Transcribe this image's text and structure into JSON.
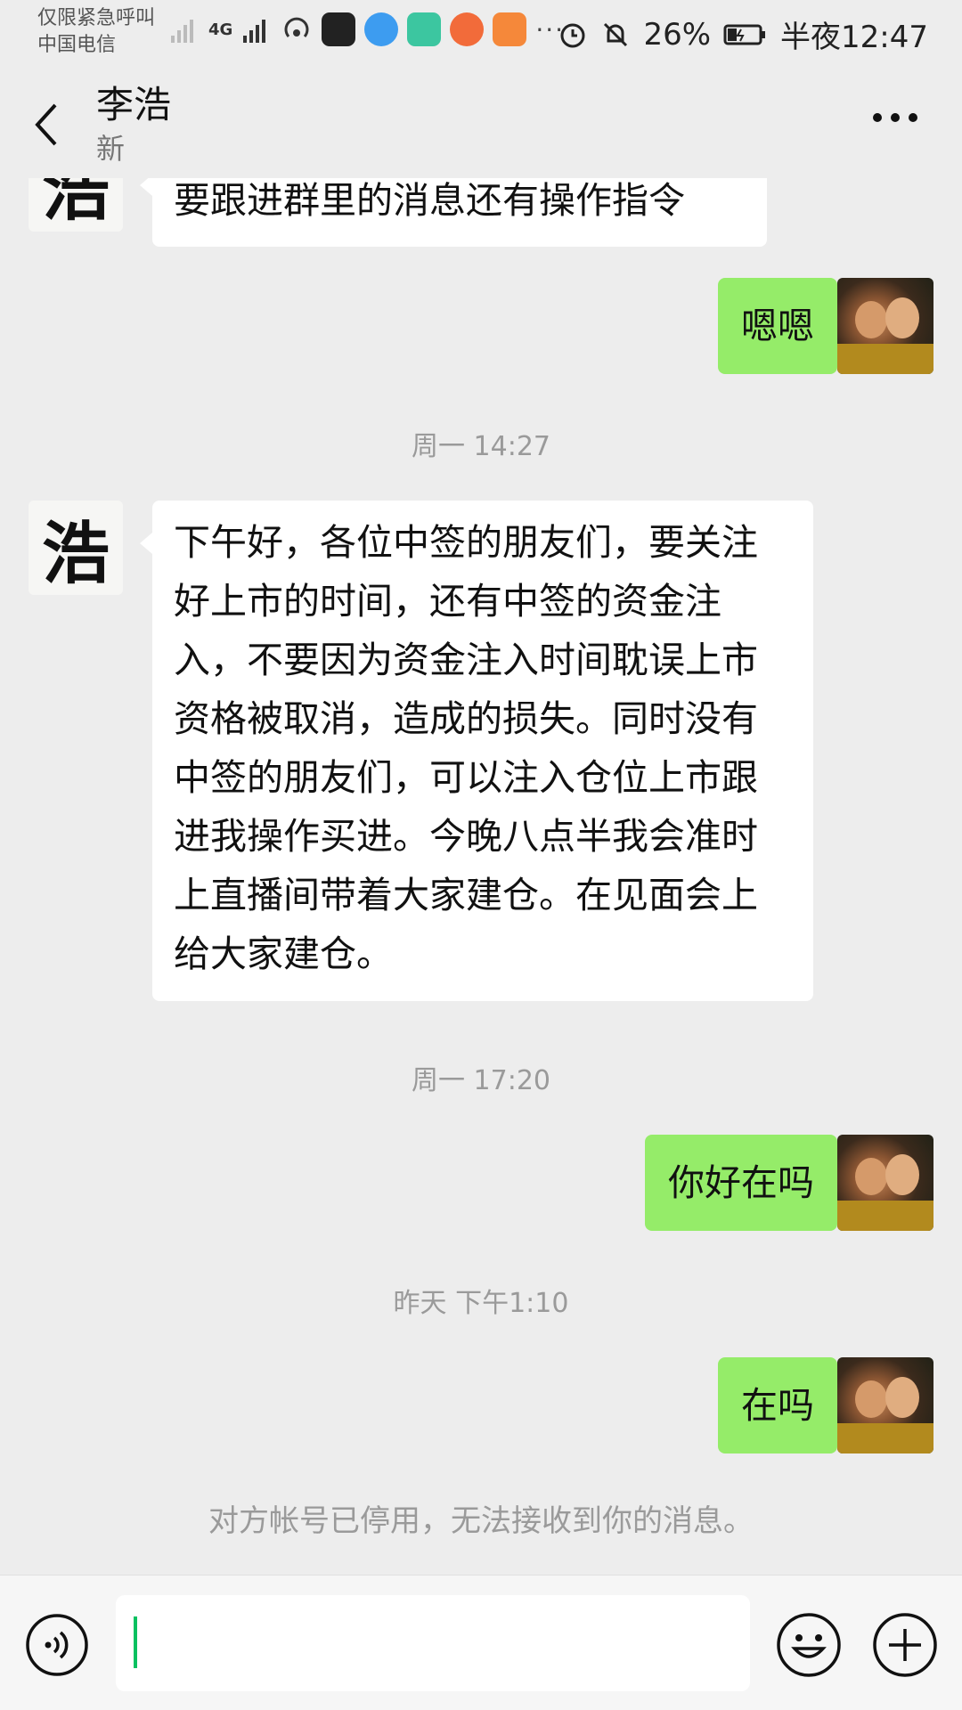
{
  "status_bar": {
    "carrier_line1": "仅限紧急呼叫",
    "carrier_line2": "中国电信",
    "network": "4G",
    "battery": "26%",
    "time": "半夜12:47",
    "more": "···"
  },
  "header": {
    "title": "李浩",
    "subtitle": "新"
  },
  "messages": {
    "m1_text": "要跟进群里的消息还有操作指令",
    "m2_text": "嗯嗯",
    "ts1": "周一 14:27",
    "m3_text": "下午好，各位中签的朋友们，要关注好上市的时间，还有中签的资金注入，不要因为资金注入时间耽误上市资格被取消，造成的损失。同时没有中签的朋友们，可以注入仓位上市跟进我操作买进。今晚八点半我会准时上直播间带着大家建仓。在见面会上给大家建仓。",
    "ts2": "周一 17:20",
    "m4_text": "你好在吗",
    "ts3": "昨天 下午1:10",
    "m5_text": "在吗",
    "system_note": "对方帐号已停用，无法接收到你的消息。"
  },
  "contact_avatar_char": "浩",
  "input": {
    "value": ""
  },
  "colors": {
    "outgoing_bubble": "#95ec69",
    "incoming_bubble": "#ffffff",
    "background": "#ededed",
    "caret": "#07c160"
  }
}
